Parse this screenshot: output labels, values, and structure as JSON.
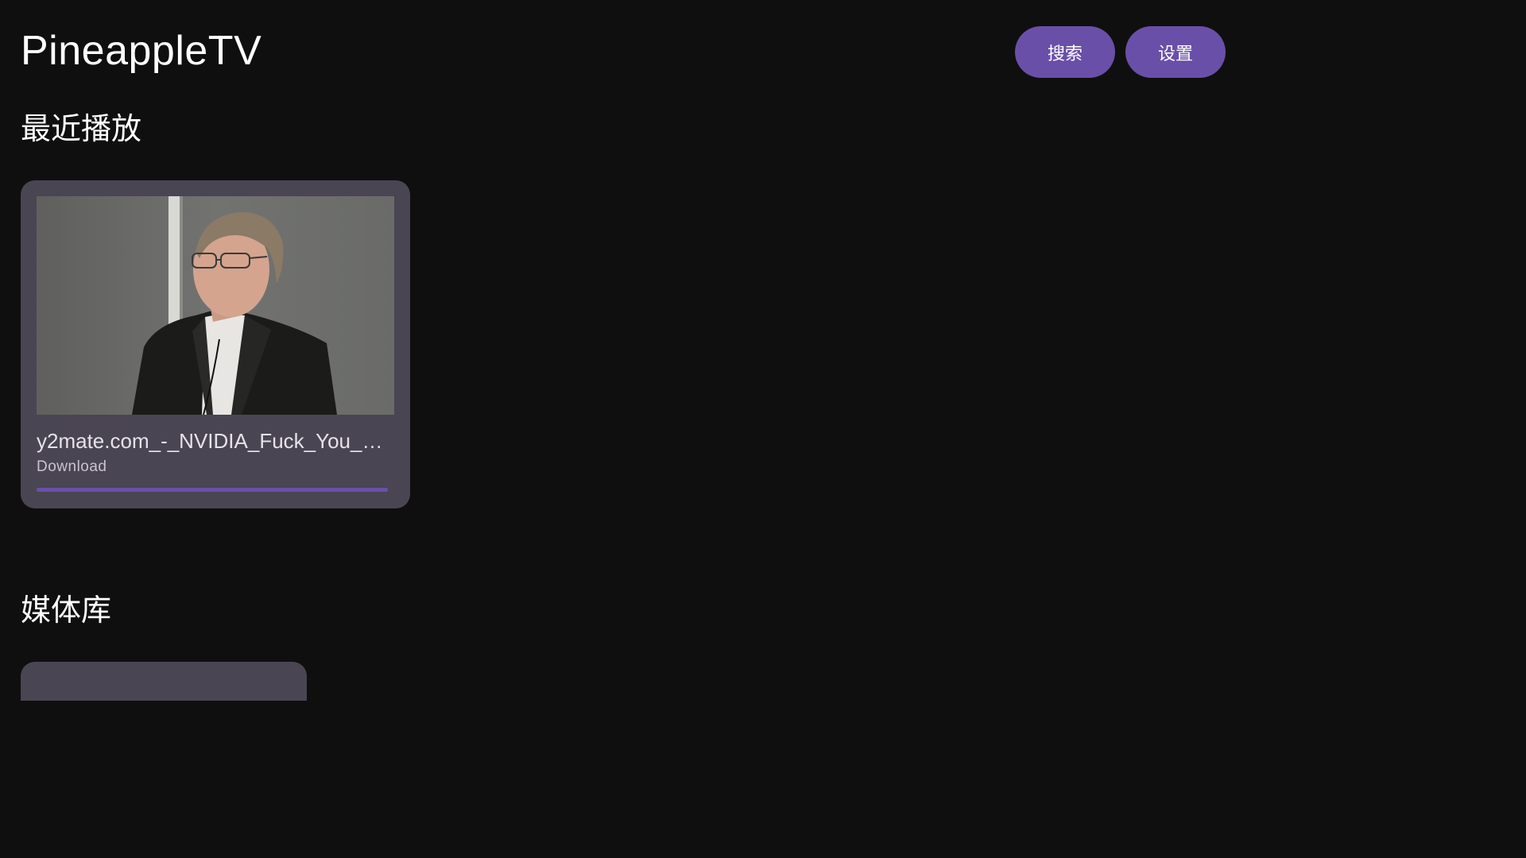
{
  "app": {
    "title": "PineappleTV"
  },
  "header": {
    "search_label": "搜索",
    "settings_label": "设置"
  },
  "sections": {
    "recent_title": "最近播放",
    "library_title": "媒体库"
  },
  "recent": [
    {
      "name": "y2mate.com_-_NVIDIA_Fuck_You_H…",
      "source": "Download",
      "progress_percent": 100
    }
  ],
  "colors": {
    "background": "#0f0f10",
    "accent": "#6a4fa8",
    "card": "#4a4552"
  }
}
